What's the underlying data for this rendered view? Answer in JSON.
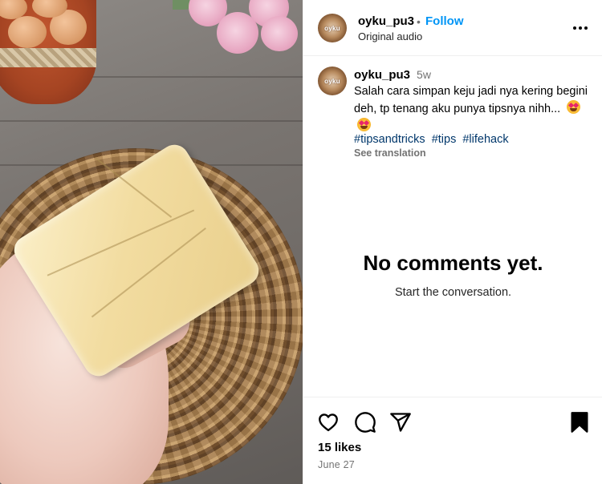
{
  "post": {
    "media_alt_icon": "post-image"
  },
  "header": {
    "username": "oyku_pu3",
    "separator": "•",
    "follow_label": "Follow",
    "audio": "Original audio",
    "avatar_text": "oyku",
    "more_icon": "more-horizontal-icon"
  },
  "caption": {
    "username": "oyku_pu3",
    "time": "5w",
    "text": "Salah cara simpan keju jadi nya kering begini deh, tp tenang aku punya tipsnya nihh...",
    "emoji": "heart-eyes-emoji",
    "hashtags": [
      "#tipsandtricks",
      "#tips",
      "#lifehack"
    ],
    "see_translation": "See translation"
  },
  "comments": {
    "empty_title": "No comments yet.",
    "empty_subtitle": "Start the conversation."
  },
  "actions": {
    "like_icon": "heart-icon",
    "comment_icon": "comment-icon",
    "share_icon": "send-icon",
    "save_icon": "bookmark-icon",
    "likes_text": "15 likes",
    "date": "June 27"
  },
  "colors": {
    "accent": "#0095f6",
    "hashtag": "#00376b",
    "muted": "#737373"
  }
}
